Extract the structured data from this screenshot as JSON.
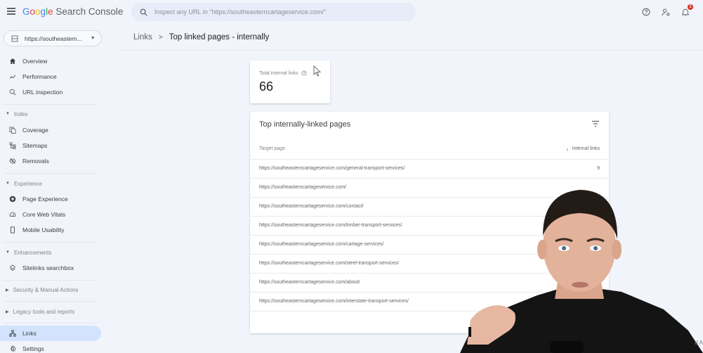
{
  "app": {
    "brand_google": "Google",
    "brand_product": "Search Console"
  },
  "search": {
    "placeholder": "Inspect any URL in \"https://southeasterncartageservice.com/\""
  },
  "header_icons": {
    "help": "help-icon",
    "account": "manage-users-icon",
    "notifications": "notifications-icon",
    "notification_count": "1"
  },
  "property": {
    "label": "https://southeastern..."
  },
  "sidebar": {
    "items": [
      {
        "label": "Overview",
        "icon": "home-icon"
      },
      {
        "label": "Performance",
        "icon": "trending-icon"
      },
      {
        "label": "URL inspection",
        "icon": "search-icon"
      }
    ],
    "sections": [
      {
        "label": "Index",
        "items": [
          {
            "label": "Coverage",
            "icon": "file-copy-icon"
          },
          {
            "label": "Sitemaps",
            "icon": "sitemap-icon"
          },
          {
            "label": "Removals",
            "icon": "removals-icon"
          }
        ]
      },
      {
        "label": "Experience",
        "items": [
          {
            "label": "Page Experience",
            "icon": "page-experience-icon"
          },
          {
            "label": "Core Web Vitals",
            "icon": "gauge-icon"
          },
          {
            "label": "Mobile Usability",
            "icon": "phone-icon"
          }
        ]
      },
      {
        "label": "Enhancements",
        "items": [
          {
            "label": "Sitelinks searchbox",
            "icon": "layers-icon"
          }
        ]
      },
      {
        "label": "Security & Manual Actions",
        "items": []
      },
      {
        "label": "Legacy tools and reports",
        "items": []
      }
    ],
    "bottom_items": [
      {
        "label": "Links",
        "icon": "links-icon",
        "active": true
      },
      {
        "label": "Settings",
        "icon": "settings-icon"
      }
    ]
  },
  "breadcrumb": {
    "parent": "Links",
    "current": "Top linked pages - internally"
  },
  "summary": {
    "label": "Total internal links",
    "value": "66"
  },
  "table": {
    "title": "Top internally-linked pages",
    "columns": {
      "target": "Target page",
      "links": "Internal links"
    },
    "rows": [
      {
        "url": "https://southeasterncartageservice.com/general-transport-services/",
        "count": "9"
      },
      {
        "url": "https://southeasterncartageservice.com/",
        "count": ""
      },
      {
        "url": "https://southeasterncartageservice.com/contact/",
        "count": ""
      },
      {
        "url": "https://southeasterncartageservice.com/timber-transport-services/",
        "count": ""
      },
      {
        "url": "https://southeasterncartageservice.com/cartage-services/",
        "count": ""
      },
      {
        "url": "https://southeasterncartageservice.com/steel-transport-services/",
        "count": ""
      },
      {
        "url": "https://southeasterncartageservice.com/about/",
        "count": ""
      },
      {
        "url": "https://southeasterncartageservice.com/interstate-transport-services/",
        "count": ""
      }
    ]
  },
  "overlay": {
    "partial_text": "d A"
  },
  "colors": {
    "accent": "#1a73e8",
    "active_nav": "#d3e3fd",
    "background": "#f1f4fb",
    "badge": "#d93025"
  }
}
